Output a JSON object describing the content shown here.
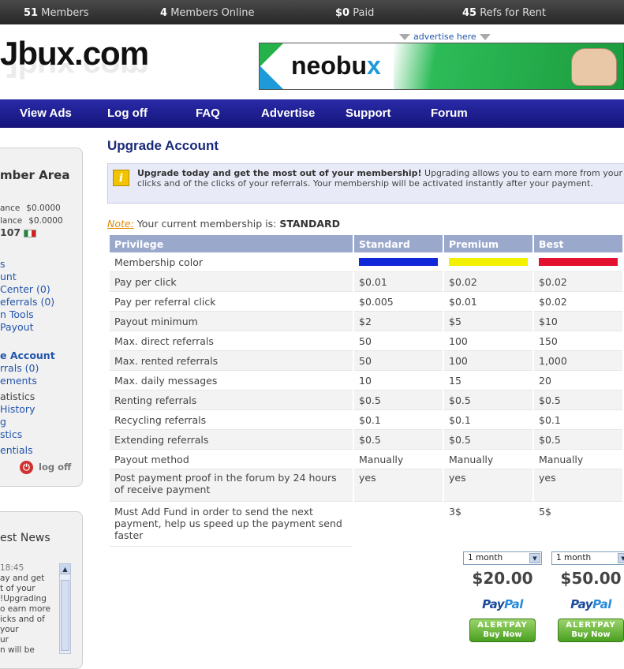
{
  "topbar": {
    "members_num": "51",
    "members_label": "Members",
    "online_num": "4",
    "online_label": "Members Online",
    "paid_num": "$0",
    "paid_label": "Paid",
    "refs_num": "45",
    "refs_label": "Refs for Rent"
  },
  "header": {
    "logo": "Jbux.com",
    "advertise_link": "advertise here",
    "banner_text_1": "neobu",
    "banner_text_2": "x"
  },
  "nav": {
    "items": [
      "View Ads",
      "Log off",
      "FAQ",
      "Advertise",
      "Support",
      "Forum"
    ]
  },
  "sidebar": {
    "title": "mber Area",
    "balance1_label": "ance",
    "balance1_value": "$0.0000",
    "balance2_label": "lance",
    "balance2_value": "$0.0000",
    "user_id": "107",
    "links": [
      {
        "text": "s",
        "style": "link"
      },
      {
        "text": "unt",
        "style": "link"
      },
      {
        "text": " Center (0)",
        "style": "link"
      },
      {
        "text": "eferrals (0)",
        "style": "link"
      },
      {
        "text": "n Tools",
        "style": "link"
      },
      {
        "text": " Payout",
        "style": "link"
      },
      {
        "text": "e Account",
        "style": "link bold"
      },
      {
        "text": "rrals (0)",
        "style": "link"
      },
      {
        "text": "ements",
        "style": "link"
      },
      {
        "text": "atistics",
        "style": "gray"
      },
      {
        "text": " History",
        "style": "link"
      },
      {
        "text": "g",
        "style": "link"
      },
      {
        "text": "stics",
        "style": "link"
      },
      {
        "text": "entials",
        "style": "link"
      }
    ],
    "logoff": "log off",
    "news_title": "est News",
    "news_time": "18:45",
    "news_lines": [
      "ay and get",
      "t of your",
      "!Upgrading",
      "o earn more",
      "icks and of",
      " your",
      "ur",
      "n will be"
    ]
  },
  "main": {
    "title": "Upgrade Account",
    "info_bold": "Upgrade today and get the most out of your membership!",
    "info_text": " Upgrading allows you to earn more from your clicks and of the clicks of your referrals. Your membership will be activated instantly after your payment.",
    "note_label": "Note:",
    "note_text": " Your current membership is: ",
    "note_value": "STANDARD",
    "table": {
      "headers": [
        "Privilege",
        "Standard",
        "Premium",
        "Best"
      ],
      "membership_color_label": "Membership color",
      "colors": [
        "#1028d8",
        "#f2f200",
        "#e41030"
      ],
      "rows": [
        [
          "Pay per click",
          "$0.01",
          "$0.02",
          "$0.02"
        ],
        [
          "Pay per referral click",
          "$0.005",
          "$0.01",
          "$0.02"
        ],
        [
          "Payout minimum",
          "$2",
          "$5",
          "$10"
        ],
        [
          "Max. direct referrals",
          "50",
          "100",
          "150"
        ],
        [
          "Max. rented referrals",
          "50",
          "100",
          "1,000"
        ],
        [
          "Max. daily messages",
          "10",
          "15",
          "20"
        ],
        [
          "Renting referrals",
          "$0.5",
          "$0.5",
          "$0.5"
        ],
        [
          "Recycling referrals",
          "$0.1",
          "$0.1",
          "$0.1"
        ],
        [
          "Extending referrals",
          "$0.5",
          "$0.5",
          "$0.5"
        ],
        [
          "Payout method",
          "Manually",
          "Manually",
          "Manually"
        ],
        [
          "Post payment proof in the forum by 24 hours of receive payment",
          "yes",
          "yes",
          "yes"
        ],
        [
          "Must Add Fund in order to send the next payment, help us speed up the payment send faster",
          "",
          "3$",
          "5$"
        ]
      ]
    },
    "plans": [
      {
        "duration": "1 month",
        "price": "$20.00"
      },
      {
        "duration": "1 month",
        "price": "$50.00"
      }
    ],
    "paypal_1": "Pay",
    "paypal_2": "Pal",
    "alertpay_1": "ALERTPAY",
    "alertpay_2": "Buy Now"
  }
}
